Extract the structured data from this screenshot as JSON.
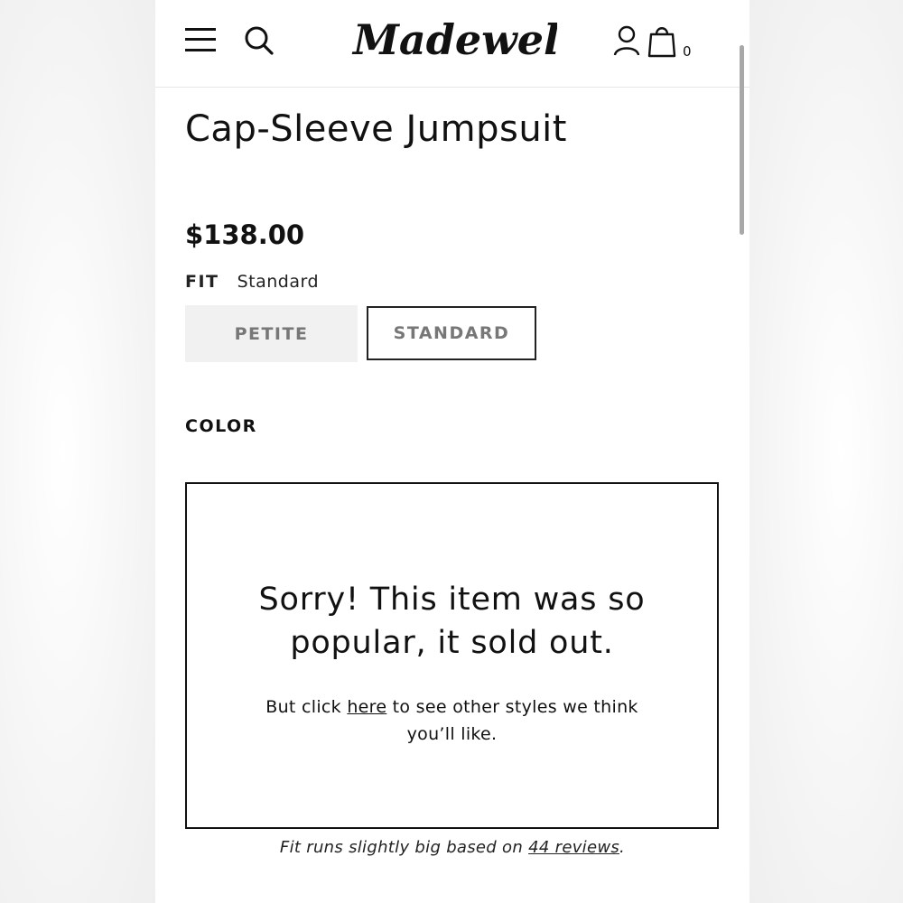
{
  "header": {
    "logo_text": "Madewell",
    "bag_count": "0",
    "icons": [
      "menu-icon",
      "search-icon",
      "account-icon",
      "bag-icon"
    ]
  },
  "product": {
    "title": "Cap-Sleeve Jumpsuit",
    "price": "$138.00",
    "fit_label": "FIT",
    "fit_selected": "Standard",
    "fit_options": [
      "PETITE",
      "STANDARD"
    ],
    "color_label": "COLOR"
  },
  "soldout": {
    "heading_line1": "Sorry! This item was so",
    "heading_line2": "popular, it sold out.",
    "body_prefix": "But click ",
    "body_link": "here",
    "body_suffix_line1": " to see other styles we think",
    "body_line2": "you’ll like."
  },
  "fit_note": {
    "prefix": "Fit runs slightly big based on ",
    "link": "44 reviews",
    "suffix": "."
  },
  "colors": {
    "text": "#111111",
    "petite_bg": "#f1f1f1",
    "button_text": "#777777"
  }
}
